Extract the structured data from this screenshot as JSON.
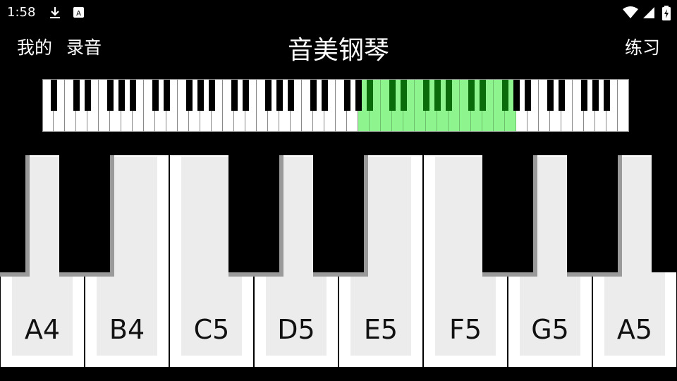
{
  "status_bar": {
    "time": "1:58",
    "icons": [
      "download-icon",
      "accessibility-icon",
      "wifi-icon",
      "signal-icon",
      "battery-icon"
    ]
  },
  "appbar": {
    "left_items": [
      "我的",
      "录音"
    ],
    "title": "音美钢琴",
    "right_item": "练习"
  },
  "overview": {
    "white_key_count": 52,
    "highlight_white_range": [
      28,
      41
    ],
    "highlight_color": "#8ef58e",
    "highlight_black_color": "#0a6b0a"
  },
  "keys": {
    "white": [
      "A4",
      "B4",
      "C5",
      "D5",
      "E5",
      "F5",
      "G5",
      "A5"
    ]
  },
  "colors": {
    "background": "#000000",
    "white_key_face": "#ececec",
    "key_shadow": "#9a9a9a"
  }
}
